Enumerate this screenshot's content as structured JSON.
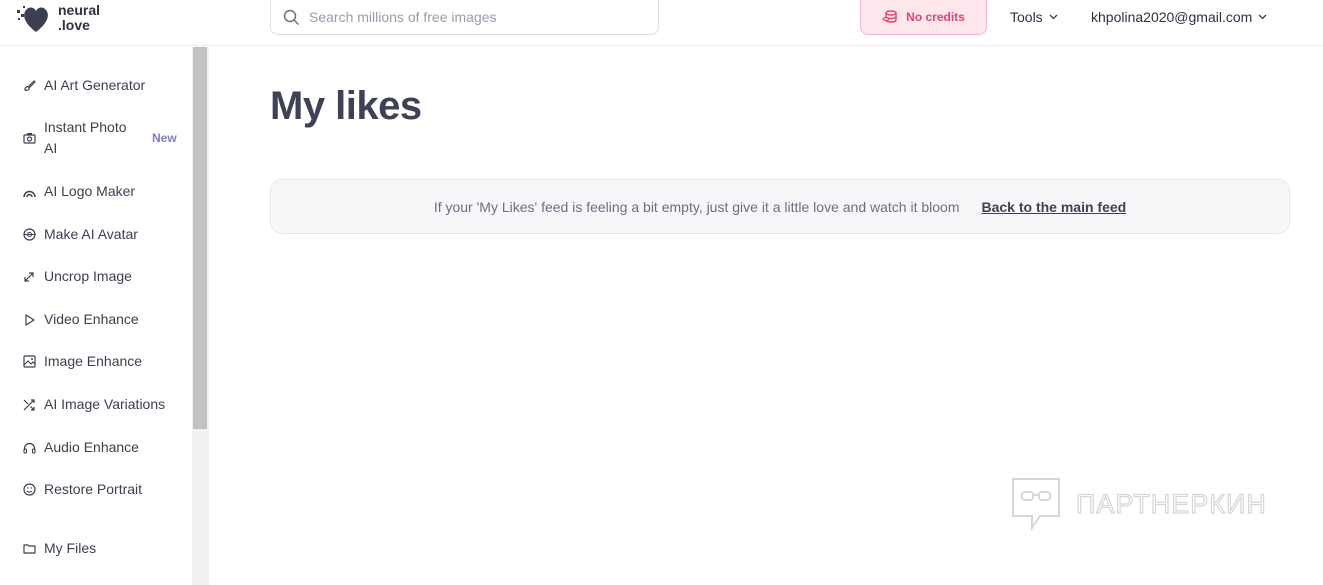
{
  "header": {
    "logo_line1": "neural",
    "logo_line2": ".love",
    "search_placeholder": "Search millions of free images",
    "credits_label": "No credits",
    "tools_label": "Tools",
    "account_email": "khpolina2020@gmail.com"
  },
  "sidebar": {
    "items": [
      {
        "label": "AI Art Generator",
        "icon": "brush-icon"
      },
      {
        "label": "Instant Photo AI",
        "icon": "camera-icon",
        "badge": "New"
      },
      {
        "label": "AI Logo Maker",
        "icon": "logo-icon"
      },
      {
        "label": "Make AI Avatar",
        "icon": "avatar-icon"
      },
      {
        "label": "Uncrop Image",
        "icon": "expand-icon"
      },
      {
        "label": "Video Enhance",
        "icon": "play-icon"
      },
      {
        "label": "Image Enhance",
        "icon": "image-icon"
      },
      {
        "label": "AI Image Variations",
        "icon": "shuffle-icon"
      },
      {
        "label": "Audio Enhance",
        "icon": "headphones-icon"
      },
      {
        "label": "Restore Portrait",
        "icon": "smile-icon"
      },
      {
        "label": "My Files",
        "icon": "folder-icon"
      }
    ],
    "instant_photo_line1": "Instant Photo",
    "instant_photo_line2": "AI"
  },
  "main": {
    "title": "My likes",
    "notice_text": "If your 'My Likes' feed is feeling a bit empty, just give it a little love and watch it bloom",
    "notice_link": "Back to the main feed"
  },
  "watermark": {
    "text": "ПАРТНЕРКИН"
  },
  "colors": {
    "accent_pink": "#e3436c",
    "credits_bg": "#fde7ec",
    "badge_purple": "#7d7cc4",
    "title": "#3f4254"
  }
}
